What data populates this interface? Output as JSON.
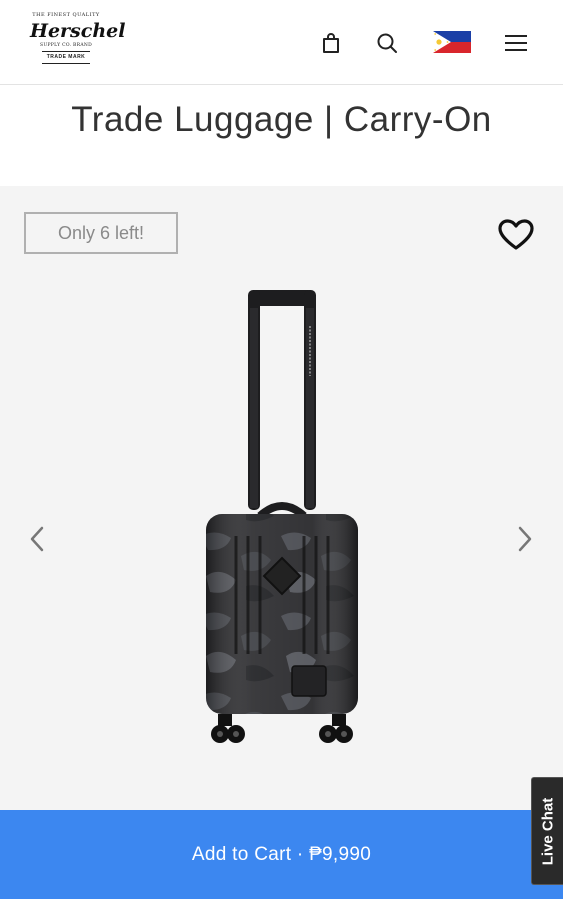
{
  "header": {
    "logo": {
      "tagline": "THE FINEST QUALITY",
      "brand": "Herschel",
      "supply": "SUPPLY CO. BRAND",
      "trademark": "TRADE MARK"
    },
    "icons": [
      "bag-icon",
      "search-icon",
      "philippines-flag-icon",
      "menu-icon"
    ]
  },
  "product": {
    "title": "Trade Luggage | Carry-On",
    "stock_badge": "Only 6 left!",
    "image_label": "HERSCHEL SUPPLY COMPANY"
  },
  "gallery": {
    "icons": [
      "heart-icon",
      "chevron-left-icon",
      "chevron-right-icon"
    ]
  },
  "cart": {
    "label": "Add to Cart · ₱9,990"
  },
  "live_chat": {
    "label": "Live Chat"
  },
  "colors": {
    "cart_button": "#3c87f0",
    "gallery_bg": "#f4f4f4",
    "live_chat_bg": "#2a2a2a",
    "text": "#333333"
  }
}
